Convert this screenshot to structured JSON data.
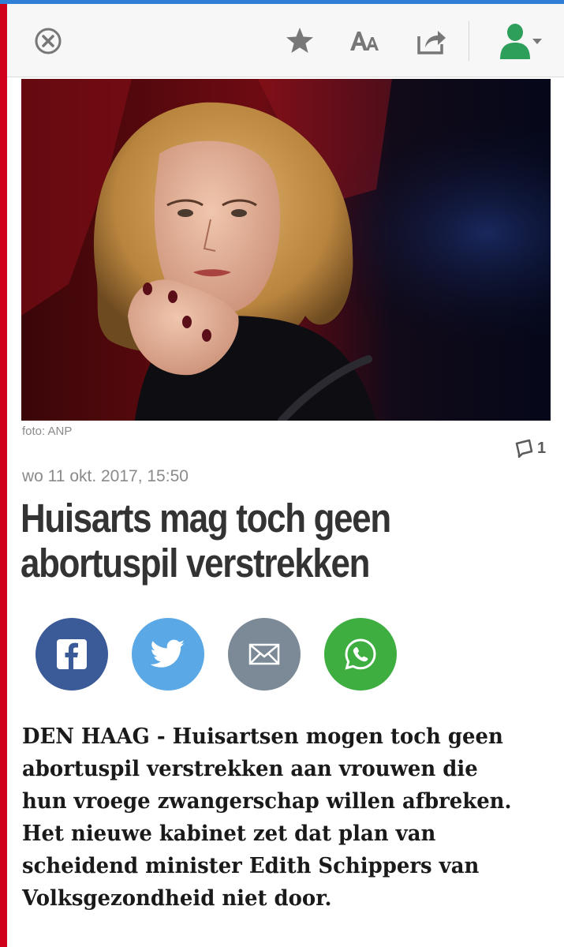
{
  "colors": {
    "top_bar": "#2f7fd6",
    "left_accent": "#d0021b",
    "toolbar_bg": "#f7f7f7",
    "user_icon": "#2e9e5b",
    "facebook": "#3b5a98",
    "twitter": "#5aa9e6",
    "mail": "#7b8a96",
    "whatsapp": "#3dae3f"
  },
  "toolbar": {
    "icons": [
      "close-icon",
      "star-icon",
      "text-size-icon",
      "share-icon",
      "user-icon",
      "chevron-down-icon"
    ]
  },
  "article": {
    "photo_credit": "foto: ANP",
    "comment_count": "1",
    "date": "wo 11 okt. 2017, 15:50",
    "headline_line1": "Huisarts mag toch geen",
    "headline_line2": "abortuspil verstrekken",
    "lead": "DEN HAAG - Huisartsen mogen toch geen abortuspil verstrekken aan vrouwen die hun vroege zwangerschap willen afbreken. Het nieuwe kabinet zet dat plan van scheidend minister Edith Schippers van Volksgezondheid niet door."
  },
  "share_buttons": [
    "facebook-icon",
    "twitter-icon",
    "mail-icon",
    "whatsapp-icon"
  ]
}
